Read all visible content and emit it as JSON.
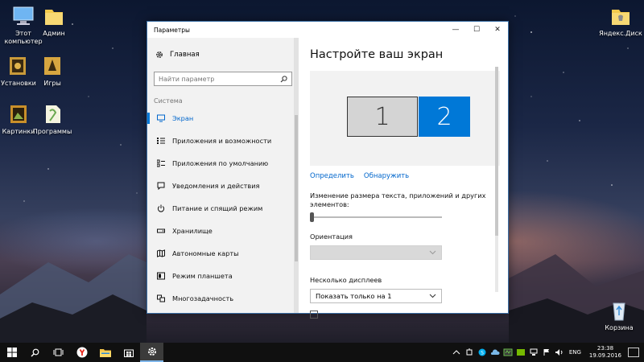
{
  "desktop": {
    "icons": [
      {
        "label": "Этот компьютер"
      },
      {
        "label": "Админ"
      },
      {
        "label": "Установки"
      },
      {
        "label": "Игры"
      },
      {
        "label": "Картинки"
      },
      {
        "label": "Программы"
      },
      {
        "label": "Яндекс.Диск"
      },
      {
        "label": "Корзина"
      }
    ]
  },
  "window": {
    "title": "Параметры",
    "controls": {
      "minimize": "—",
      "maximize": "☐",
      "close": "✕"
    }
  },
  "nav": {
    "home_label": "Главная",
    "search": {
      "placeholder": "Найти параметр",
      "value": ""
    },
    "section_label": "Система",
    "items": [
      {
        "label": "Экран",
        "icon": "display-icon",
        "active": true
      },
      {
        "label": "Приложения и возможности",
        "icon": "apps-list-icon",
        "active": false
      },
      {
        "label": "Приложения по умолчанию",
        "icon": "default-apps-icon",
        "active": false
      },
      {
        "label": "Уведомления и действия",
        "icon": "notifications-icon",
        "active": false
      },
      {
        "label": "Питание и спящий режим",
        "icon": "power-icon",
        "active": false
      },
      {
        "label": "Хранилище",
        "icon": "storage-icon",
        "active": false
      },
      {
        "label": "Автономные карты",
        "icon": "offline-maps-icon",
        "active": false
      },
      {
        "label": "Режим планшета",
        "icon": "tablet-mode-icon",
        "active": false
      },
      {
        "label": "Многозадачность",
        "icon": "multitasking-icon",
        "active": false
      }
    ]
  },
  "main": {
    "heading": "Настройте ваш экран",
    "monitors": [
      {
        "number": "1",
        "selected": false
      },
      {
        "number": "2",
        "selected": true
      }
    ],
    "links": {
      "identify": "Определить",
      "detect": "Обнаружить"
    },
    "scale_label": "Изменение размера текста, приложений и других элементов:",
    "scale_value": 0.0,
    "orientation_label": "Ориентация",
    "orientation_value": "",
    "multi_display_label": "Несколько дисплеев",
    "multi_display_value": "Показать только на 1"
  },
  "taskbar": {
    "buttons": [
      {
        "name": "start-button",
        "icon": "windows-logo-icon"
      },
      {
        "name": "search-button",
        "icon": "search-icon"
      },
      {
        "name": "task-view-button",
        "icon": "task-view-icon"
      },
      {
        "name": "yandex-browser-button",
        "icon": "yandex-icon"
      },
      {
        "name": "file-explorer-button",
        "icon": "folder-icon"
      },
      {
        "name": "store-button",
        "icon": "store-icon"
      },
      {
        "name": "settings-button",
        "icon": "gear-icon",
        "active": true
      }
    ],
    "tray": {
      "language": "ENG",
      "time": "23:38",
      "date": "19.09.2016"
    }
  },
  "colors": {
    "accent": "#0078d7",
    "link": "#0066cc",
    "taskbar": "#101010"
  }
}
